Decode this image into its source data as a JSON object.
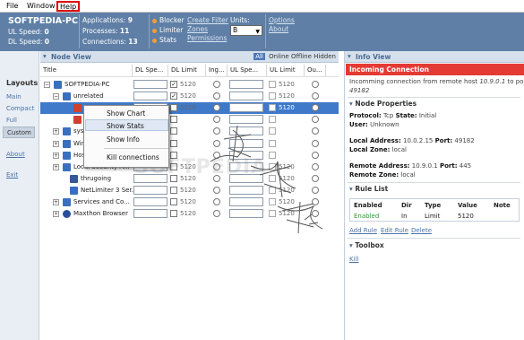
{
  "menubar": {
    "file": "File",
    "window": "Window",
    "help": "Help"
  },
  "status": {
    "pc_name": "SOFTPEDIA-PC",
    "ul_speed_label": "UL Speed:",
    "ul_speed": "0",
    "dl_speed_label": "DL Speed:",
    "dl_speed": "0",
    "applications_label": "Applications:",
    "applications": "9",
    "processes_label": "Processes:",
    "processes": "11",
    "connections_label": "Connections:",
    "connections": "13",
    "blocker": "Blocker",
    "limiter": "Limiter",
    "stats": "Stats",
    "create_filter": "Create Filter",
    "zones": "Zones",
    "permissions": "Permissions",
    "units_label": "Units:",
    "units_value": "B",
    "options": "Options",
    "about": "About",
    "accent_dot": "#f0a030"
  },
  "sidebar": {
    "layouts_label": "Layouts",
    "main": "Main",
    "compact": "Compact",
    "full": "Full",
    "custom": "Custom",
    "about": "About",
    "exit": "Exit"
  },
  "nodeview": {
    "title": "Node View",
    "filter_all": "All",
    "filter_online": "Online",
    "filter_offline": "Offline",
    "filter_hidden": "Hidden",
    "columns": [
      "Title",
      "DL Spe...",
      "DL Limit",
      "Ing...",
      "UL Spe...",
      "UL Limit",
      "Ou..."
    ],
    "rows": [
      {
        "name": "SOFTPEDIA-PC",
        "dl_limit": "5120",
        "ul_limit": "5120",
        "dl_checked": true
      },
      {
        "name": "unrelated",
        "dl_limit": "5120",
        "ul_limit": "5120",
        "dl_checked": true
      },
      {
        "name": "",
        "dl_limit": "5120",
        "ul_limit": "5120",
        "dl_checked": false
      },
      {
        "name": "",
        "dl_limit": "",
        "ul_limit": "",
        "dl_checked": false
      },
      {
        "name": "sys",
        "dl_limit": "",
        "ul_limit": "",
        "dl_checked": false
      },
      {
        "name": "Win",
        "dl_limit": "",
        "ul_limit": "",
        "dl_checked": false
      },
      {
        "name": "Hos",
        "dl_limit": "",
        "ul_limit": "",
        "dl_checked": false
      },
      {
        "name": "Local Security A...",
        "dl_limit": "5120",
        "ul_limit": "5120",
        "dl_checked": false
      },
      {
        "name": "thrugoing",
        "dl_limit": "5120",
        "ul_limit": "5120",
        "dl_checked": false
      },
      {
        "name": "NetLimiter 3 Ser...",
        "dl_limit": "5120",
        "ul_limit": "5120",
        "dl_checked": false
      },
      {
        "name": "Services and Co...",
        "dl_limit": "5120",
        "ul_limit": "5120",
        "dl_checked": false
      },
      {
        "name": "Maxthon Browser",
        "dl_limit": "5120",
        "ul_limit": "5120",
        "dl_checked": false
      }
    ]
  },
  "context_menu": {
    "show_chart": "Show Chart",
    "show_stats": "Show Stats",
    "show_info": "Show Info",
    "kill_connections": "Kill connections"
  },
  "watermark": "SOFTPEDIA",
  "infoview": {
    "title": "Info View",
    "incoming": "Incoming Connection",
    "desc_prefix": "Incomming connection from remote host ",
    "desc_host": "10.9.0.1",
    "desc_mid": " to port",
    "desc_port": "49182",
    "node_properties": "Node Properties",
    "protocol_label": "Protocol:",
    "protocol": "Tcp",
    "state_label": "State:",
    "state": "Initial",
    "user_label": "User:",
    "user": "Unknown",
    "local_address_label": "Local Address:",
    "local_address": "10.0.2.15",
    "port_label": "Port:",
    "local_port": "49182",
    "local_zone_label": "Local Zone:",
    "local_zone": "local",
    "remote_address_label": "Remote Address:",
    "remote_address": "10.9.0.1",
    "remote_port": "445",
    "remote_zone_label": "Remote Zone:",
    "remote_zone": "local",
    "rule_list": "Rule List",
    "rule_cols": [
      "Enabled",
      "Dir",
      "Type",
      "Value",
      "Note"
    ],
    "rule_row": {
      "enabled": "Enabled",
      "dir": "In",
      "type": "Limit",
      "value": "5120",
      "note": ""
    },
    "add_rule": "Add Rule",
    "edit_rule": "Edit Rule",
    "delete": "Delete",
    "toolbox": "Toolbox",
    "kill": "Kill",
    "accent_red": "#e43a34",
    "enabled_color": "#2a9a2a"
  }
}
